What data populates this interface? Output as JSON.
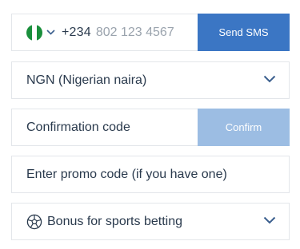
{
  "phone": {
    "country_flag": "nigeria-flag-icon",
    "dial_code": "+234",
    "placeholder": "802 123 4567",
    "send_sms_label": "Send SMS",
    "send_sms_color": "#3b76c4"
  },
  "currency": {
    "selected": "NGN (Nigerian naira)"
  },
  "confirmation": {
    "placeholder": "Confirmation code",
    "confirm_label": "Confirm",
    "confirm_color": "#9cbde3"
  },
  "promo": {
    "placeholder": "Enter promo code (if you have one)"
  },
  "bonus": {
    "icon": "soccer-ball-icon",
    "selected": "Bonus for sports betting"
  },
  "colors": {
    "flag_green": "#1a8f3c",
    "text": "#2a3a4d",
    "border": "#e3e6ea",
    "chevron": "#3b5f8e"
  }
}
